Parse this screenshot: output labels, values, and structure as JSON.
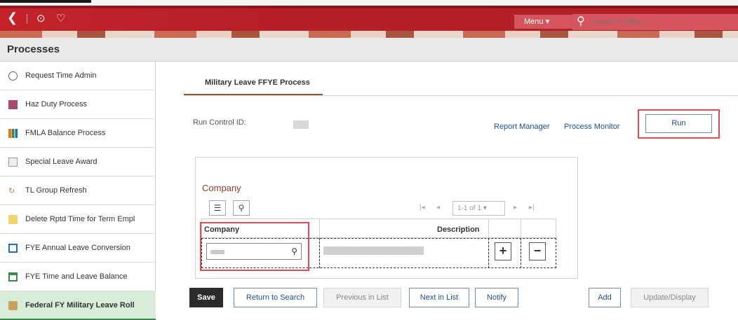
{
  "header": {
    "menu_label": "Menu ▾",
    "search_placeholder": "Search in Menu"
  },
  "page_title": "Processes",
  "sidebar": {
    "items": [
      {
        "label": "Request Time Admin",
        "icon": "clock-icon"
      },
      {
        "label": "Haz Duty Process",
        "icon": "report-icon"
      },
      {
        "label": "FMLA Balance Process",
        "icon": "bar-chart-icon"
      },
      {
        "label": "Special Leave Award",
        "icon": "award-icon"
      },
      {
        "label": "TL Group Refresh",
        "icon": "refresh-icon"
      },
      {
        "label": "Delete Rptd Time for Term Empl",
        "icon": "delete-time-icon"
      },
      {
        "label": "FYE Annual Leave Conversion",
        "icon": "calendar-convert-icon"
      },
      {
        "label": "FYE Time and Leave Balance",
        "icon": "calendar-icon"
      },
      {
        "label": "Federal FY Military Leave Roll",
        "icon": "folder-icon"
      }
    ],
    "active_index": 8
  },
  "main": {
    "tab_label": "Military Leave FFYE Process",
    "run_control_label": "Run Control ID:",
    "report_manager_link": "Report Manager",
    "process_monitor_link": "Process Monitor",
    "run_button": "Run",
    "grid": {
      "title": "Company",
      "pager": "1-1 of 1 ▾",
      "col_company": "Company",
      "col_description": "Description"
    }
  },
  "footer_buttons": {
    "save": "Save",
    "return_to_search": "Return to Search",
    "previous_in_list": "Previous in List",
    "next_in_list": "Next in List",
    "notify": "Notify",
    "add": "Add",
    "update_display": "Update/Display"
  },
  "colors": {
    "header_red": "#b51f27",
    "highlight_red": "#e04a56",
    "active_green": "#d7ecd9",
    "link_blue": "#1f4e8c"
  }
}
